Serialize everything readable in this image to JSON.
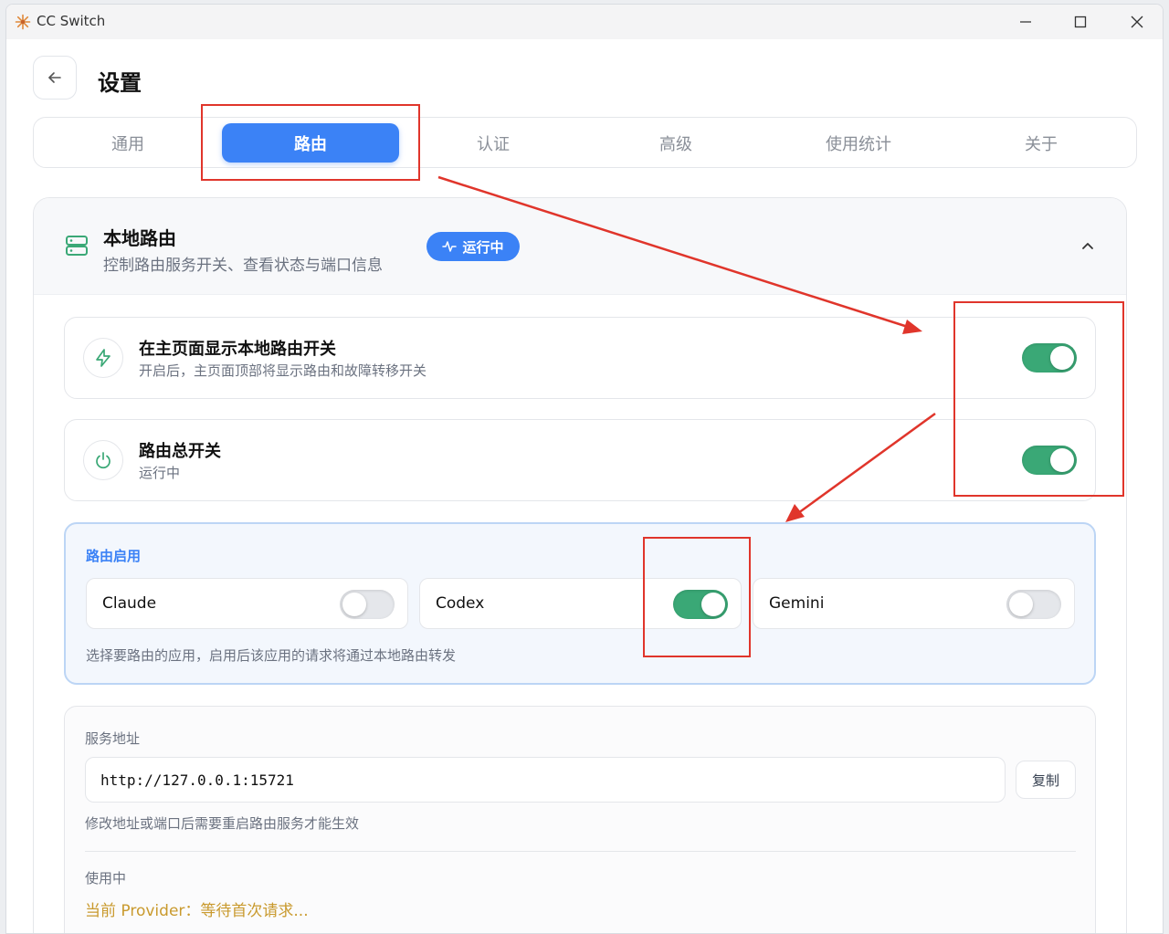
{
  "window": {
    "title": "CC Switch"
  },
  "header": {
    "title": "设置"
  },
  "tabs": [
    {
      "label": "通用",
      "active": false
    },
    {
      "label": "路由",
      "active": true
    },
    {
      "label": "认证",
      "active": false
    },
    {
      "label": "高级",
      "active": false
    },
    {
      "label": "使用统计",
      "active": false
    },
    {
      "label": "关于",
      "active": false
    }
  ],
  "local_routing": {
    "title": "本地路由",
    "subtitle": "控制路由服务开关、查看状态与端口信息",
    "badge": "运行中",
    "show_on_home": {
      "title": "在主页面显示本地路由开关",
      "subtitle": "开启后，主页面顶部将显示路由和故障转移开关",
      "enabled": true
    },
    "master_switch": {
      "title": "路由总开关",
      "subtitle": "运行中",
      "enabled": true
    },
    "routing_enabled": {
      "label": "路由启用",
      "apps": [
        {
          "name": "Claude",
          "enabled": false
        },
        {
          "name": "Codex",
          "enabled": true
        },
        {
          "name": "Gemini",
          "enabled": false
        }
      ],
      "hint": "选择要路由的应用，启用后该应用的请求将通过本地路由转发"
    },
    "service_address": {
      "label": "服务地址",
      "value": "http://127.0.0.1:15721",
      "copy_label": "复制",
      "hint": "修改地址或端口后需要重启路由服务才能生效"
    },
    "in_use": {
      "label": "使用中",
      "provider_status": "当前 Provider：等待首次请求..."
    }
  },
  "colors": {
    "accent": "#3b82f6",
    "toggle_on": "#3aa876",
    "annotation": "#e0352b",
    "provider_text": "#c99a2e"
  }
}
